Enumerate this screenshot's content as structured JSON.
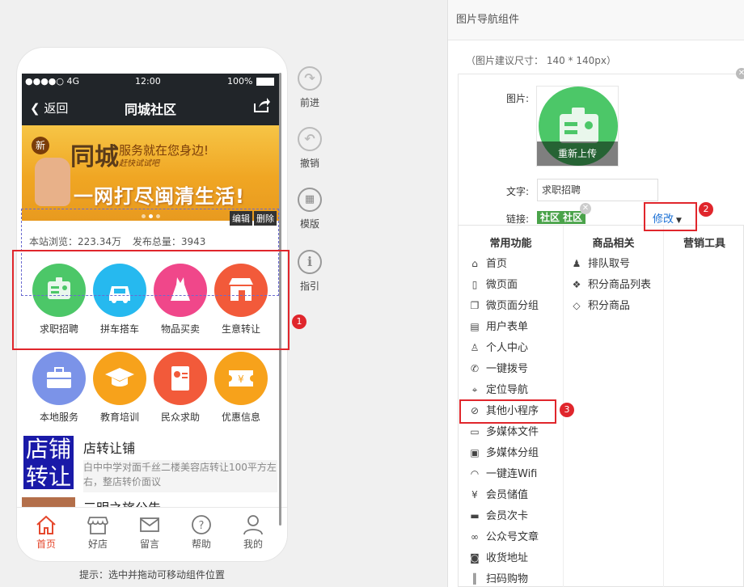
{
  "phone": {
    "status": {
      "signal": "●●●●○ 4G",
      "time": "12:00",
      "battery": "100%"
    },
    "nav": {
      "back_label": "返回",
      "title": "同城社区"
    },
    "banner": {
      "badge": "新",
      "headline": "同城",
      "slogan": "服务就在您身边!",
      "script": "赶快试试吧",
      "tagline": "一网打尽闽清生活!"
    },
    "stats": {
      "views": "本站浏览：223.34万",
      "posts": "发布总量：3943"
    },
    "selection_actions": {
      "edit": "编辑",
      "delete": "删除"
    },
    "grid_row1": [
      {
        "label": "求职招聘",
        "color": "#4cc768",
        "icon": "id-card-icon"
      },
      {
        "label": "拼车搭车",
        "color": "#26b9ef",
        "icon": "car-icon"
      },
      {
        "label": "物品买卖",
        "color": "#f0478a",
        "icon": "dress-icon"
      },
      {
        "label": "生意转让",
        "color": "#f25a3a",
        "icon": "shop-icon"
      }
    ],
    "grid_row2": [
      {
        "label": "本地服务",
        "color": "#7b93e8",
        "icon": "toolbox-icon"
      },
      {
        "label": "教育培训",
        "color": "#f7a21b",
        "icon": "graduation-cap-icon"
      },
      {
        "label": "民众求助",
        "color": "#f25a3a",
        "icon": "contact-card-icon"
      },
      {
        "label": "优惠信息",
        "color": "#f7a21b",
        "icon": "coupon-icon"
      }
    ],
    "post1": {
      "thumb_text_1": "店铺",
      "thumb_text_2": "转让",
      "title": "店转让铺",
      "desc": "白中中学对面千丝二楼美容店转让100平方左右，整店转价面议"
    },
    "post2": {
      "title": "三明之旅公告"
    },
    "tabs": [
      {
        "label": "首页",
        "icon": "home-icon",
        "active": true
      },
      {
        "label": "好店",
        "icon": "store-icon",
        "active": false
      },
      {
        "label": "留言",
        "icon": "mail-icon",
        "active": false
      },
      {
        "label": "帮助",
        "icon": "help-icon",
        "active": false
      },
      {
        "label": "我的",
        "icon": "user-icon",
        "active": false
      }
    ]
  },
  "hint": "提示：选中并拖动可移动组件位置",
  "tools": [
    {
      "label": "前进",
      "icon": "redo-icon"
    },
    {
      "label": "撤销",
      "icon": "undo-icon"
    },
    {
      "label": "模版",
      "icon": "template-icon"
    },
    {
      "label": "指引",
      "icon": "info-icon"
    }
  ],
  "callouts": [
    "1",
    "2",
    "3"
  ],
  "panel": {
    "title": "图片导航组件",
    "size_hint": "（图片建议尺寸： 140 * 140px）",
    "image_label": "图片:",
    "reupload": "重新上传",
    "text_label": "文字:",
    "text_value": "求职招聘",
    "link_label": "链接:",
    "link_tag": "社区 社区",
    "modify_label": "修改"
  },
  "menu": {
    "col1_title": "常用功能",
    "col2_title": "商品相关",
    "col3_title": "营销工具",
    "col1": [
      {
        "label": "首页",
        "icon": "home-icon",
        "glyph": "⌂"
      },
      {
        "label": "微页面",
        "icon": "page-icon",
        "glyph": "▯"
      },
      {
        "label": "微页面分组",
        "icon": "pages-icon",
        "glyph": "❐"
      },
      {
        "label": "用户表单",
        "icon": "form-icon",
        "glyph": "▤"
      },
      {
        "label": "个人中心",
        "icon": "user-icon",
        "glyph": "♙"
      },
      {
        "label": "一键拨号",
        "icon": "phone-icon",
        "glyph": "✆"
      },
      {
        "label": "定位导航",
        "icon": "location-icon",
        "glyph": "⌖"
      },
      {
        "label": "其他小程序",
        "icon": "link-icon",
        "glyph": "⊘"
      },
      {
        "label": "多媒体文件",
        "icon": "video-icon",
        "glyph": "▭"
      },
      {
        "label": "多媒体分组",
        "icon": "film-icon",
        "glyph": "▣"
      },
      {
        "label": "一键连Wifi",
        "icon": "wifi-icon",
        "glyph": "◠"
      },
      {
        "label": "会员储值",
        "icon": "yen-icon",
        "glyph": "¥"
      },
      {
        "label": "会员次卡",
        "icon": "card-icon",
        "glyph": "▬"
      },
      {
        "label": "公众号文章",
        "icon": "chain-icon",
        "glyph": "∞"
      },
      {
        "label": "收货地址",
        "icon": "contact-icon",
        "glyph": "◙"
      },
      {
        "label": "扫码购物",
        "icon": "barcode-icon",
        "glyph": "║"
      }
    ],
    "col2": [
      {
        "label": "排队取号",
        "icon": "queue-icon",
        "glyph": "♟"
      },
      {
        "label": "积分商品列表",
        "icon": "cubes-icon",
        "glyph": "❖"
      },
      {
        "label": "积分商品",
        "icon": "diamond-icon",
        "glyph": "◇"
      }
    ]
  }
}
